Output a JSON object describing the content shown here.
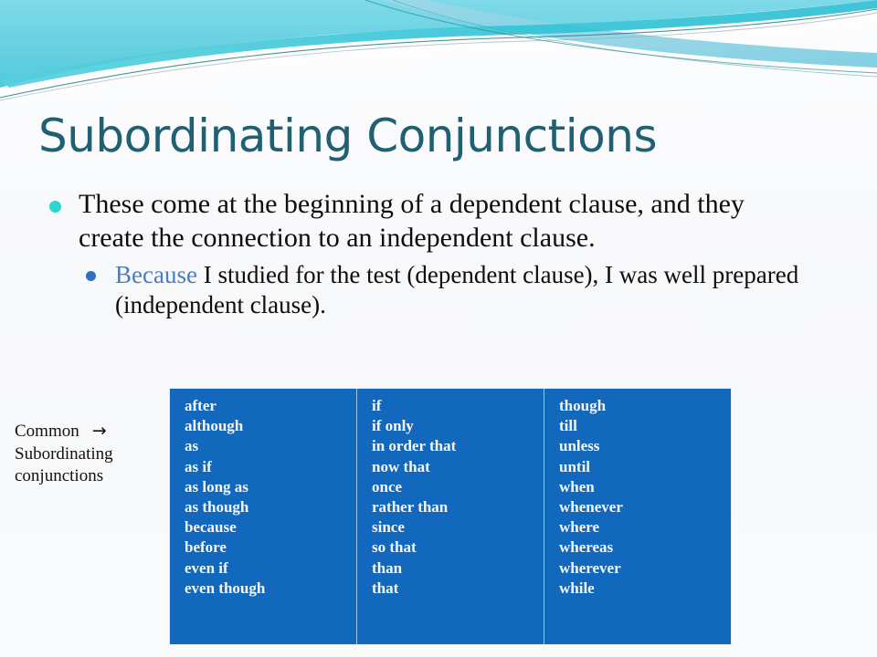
{
  "slide": {
    "title": "Subordinating Conjunctions",
    "bullets": {
      "main": "These come at the beginning of a dependent clause, and they create the connection to an independent clause.",
      "example_keyword": "Because",
      "example_rest": " I studied for the test (dependent clause), I was well prepared (independent clause)."
    },
    "caption": {
      "line1": "Common",
      "arrow": "→",
      "line2": "Subordinating",
      "line3": "conjunctions"
    },
    "colors": {
      "title": "#1f6172",
      "table_bg": "#1268bd",
      "bullet_level1": "#2cd5cd",
      "bullet_level2": "#2f6fc4",
      "keyword_blue": "#4a7ebb",
      "banner_teal": "#3ac8d8"
    }
  },
  "table": {
    "columns": [
      {
        "name": "column-1",
        "items": [
          "after",
          "although",
          "as",
          "as if",
          "as long as",
          "as though",
          "because",
          "before",
          "even if",
          "even though"
        ]
      },
      {
        "name": "column-2",
        "items": [
          "if",
          "if only",
          "in order that",
          "now that",
          "once",
          "rather than",
          "since",
          "so that",
          "than",
          "that"
        ]
      },
      {
        "name": "column-3",
        "items": [
          "though",
          "till",
          "unless",
          "until",
          "when",
          "whenever",
          "where",
          "whereas",
          "wherever",
          "while"
        ]
      }
    ]
  }
}
